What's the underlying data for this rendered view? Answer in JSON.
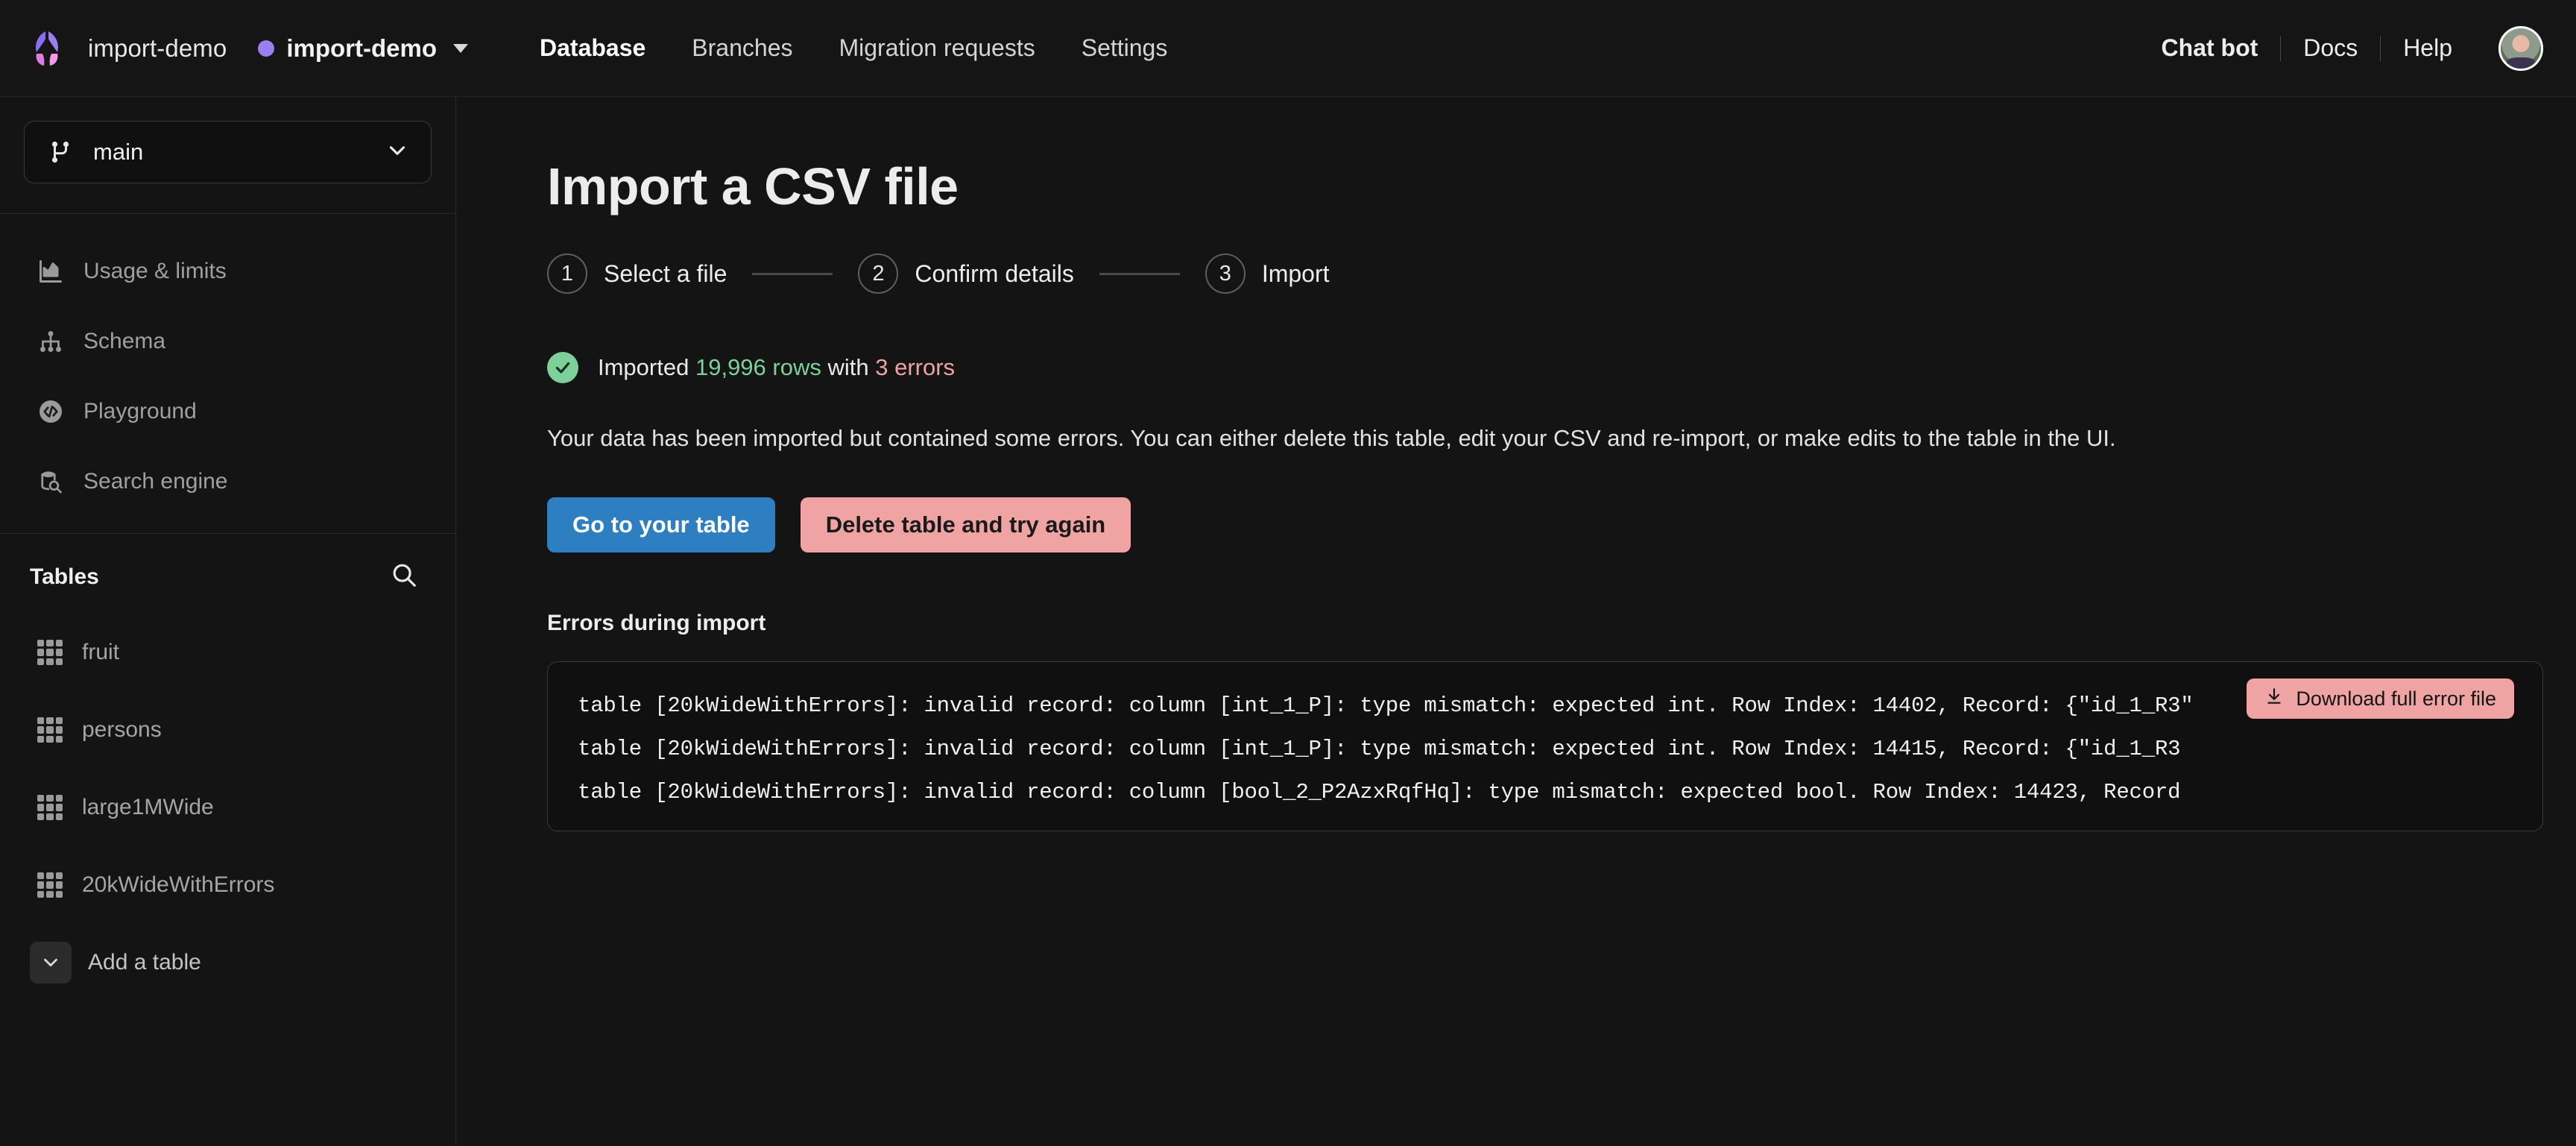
{
  "topbar": {
    "logo_icon": "xata-butterfly-logo",
    "workspace": "import-demo",
    "database": "import-demo",
    "db_dot_color": "#9b7ff0",
    "db_caret_icon": "caret-down-icon",
    "nav": [
      {
        "label": "Database",
        "active": true
      },
      {
        "label": "Branches",
        "active": false
      },
      {
        "label": "Migration requests",
        "active": false
      },
      {
        "label": "Settings",
        "active": false
      }
    ],
    "right_links": [
      {
        "label": "Chat bot",
        "strong": true
      },
      {
        "label": "Docs",
        "strong": false
      },
      {
        "label": "Help",
        "strong": false
      }
    ],
    "avatar_icon": "user-avatar"
  },
  "sidebar": {
    "branch": {
      "name": "main",
      "icon": "git-branch-icon",
      "chevron": "chevron-down-icon"
    },
    "nav_items": [
      {
        "label": "Usage & limits",
        "icon": "bar-chart-icon"
      },
      {
        "label": "Schema",
        "icon": "schema-hierarchy-icon"
      },
      {
        "label": "Playground",
        "icon": "code-circle-icon"
      },
      {
        "label": "Search engine",
        "icon": "database-search-icon"
      }
    ],
    "tables_header": {
      "title": "Tables",
      "search_icon": "search-icon"
    },
    "tables": [
      {
        "label": "fruit",
        "icon": "table-grid-icon"
      },
      {
        "label": "persons",
        "icon": "table-grid-icon"
      },
      {
        "label": "large1MWide",
        "icon": "table-grid-icon"
      },
      {
        "label": "20kWideWithErrors",
        "icon": "table-grid-icon"
      }
    ],
    "add_table": {
      "label": "Add a table",
      "icon": "chevron-down-icon"
    }
  },
  "main": {
    "page_title": "Import a CSV file",
    "steps": [
      {
        "number": "1",
        "label": "Select a file"
      },
      {
        "number": "2",
        "label": "Confirm details"
      },
      {
        "number": "3",
        "label": "Import"
      }
    ],
    "status": {
      "icon": "check-circle-icon",
      "prefix": "Imported",
      "rows": "19,996 rows",
      "middle": "with",
      "errors": "3 errors",
      "rows_color": "#7ed09a",
      "errors_color": "#f0a3a3"
    },
    "paragraph": "Your data has been imported but contained some errors. You can either delete this table, edit your CSV and re-import, or make edits to the table in the UI.",
    "buttons": {
      "primary": "Go to your table",
      "danger": "Delete table and try again",
      "primary_color": "#2d7fc1",
      "danger_color": "#f0a3a3"
    },
    "errors_section": {
      "title": "Errors during import",
      "download_button": {
        "label": "Download full error file",
        "icon": "download-icon"
      },
      "lines": [
        "table [20kWideWithErrors]: invalid record: column [int_1_P]: type mismatch: expected int. Row Index: 14402, Record: {\"id_1_R3\"",
        "table [20kWideWithErrors]: invalid record: column [int_1_P]: type mismatch: expected int. Row Index: 14415, Record: {\"id_1_R3",
        "table [20kWideWithErrors]: invalid record: column [bool_2_P2AzxRqfHq]: type mismatch: expected bool. Row Index: 14423, Record"
      ]
    }
  }
}
